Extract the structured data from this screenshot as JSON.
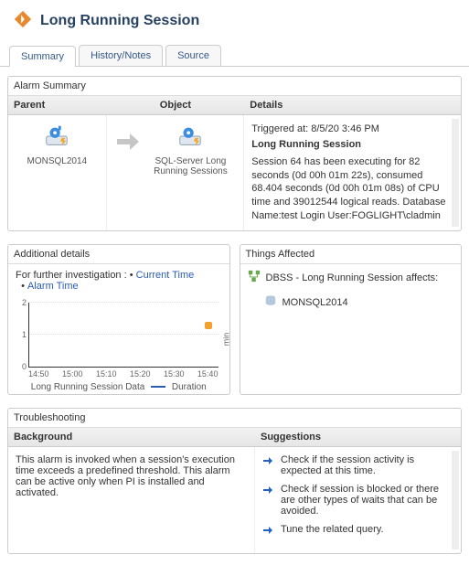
{
  "header": {
    "title": "Long Running Session"
  },
  "tabs": {
    "summary": "Summary",
    "history": "History/Notes",
    "source": "Source"
  },
  "alarm": {
    "panel_title": "Alarm Summary",
    "col_parent": "Parent",
    "col_object": "Object",
    "col_details": "Details",
    "parent_label": "MONSQL2014",
    "object_label": "SQL-Server Long Running Sessions",
    "details": {
      "triggered": "Triggered at: 8/5/20 3:46 PM",
      "title": "Long Running Session",
      "body": "Session 64 has been executing for 82 seconds (0d 00h 01m 22s), consumed 68.404 seconds (0d 00h 01m 08s) of CPU time and 39012544 logical reads. Database Name:test Login User:FOGLIGHT\\cladmin Program Name:Microsoft SQL Server Management Studio - Query Host"
    }
  },
  "additional": {
    "panel_title": "Additional details",
    "prefix": "For further investigation : ",
    "link_current": "Current Time",
    "link_alarm": "Alarm Time",
    "chart_caption_left": "Long Running Session Data",
    "chart_caption_series": "Duration",
    "axis_unit": "min"
  },
  "things": {
    "panel_title": "Things Affected",
    "line1": "DBSS - Long Running Session affects:",
    "child": "MONSQL2014"
  },
  "troubleshoot": {
    "panel_title": "Troubleshooting",
    "col_bg": "Background",
    "col_sugg": "Suggestions",
    "background": "This alarm is invoked when a session's execution time exceeds a predefined threshold. This alarm can be active only when PI is installed and activated.",
    "s1": "Check if the session activity is expected at this time.",
    "s2": "Check if session is blocked or there are other types of waits that can be avoided.",
    "s3": "Tune the related query."
  },
  "chart_data": {
    "type": "scatter",
    "x_ticks": [
      "14:50",
      "15:00",
      "15:10",
      "15:20",
      "15:30",
      "15:40"
    ],
    "y_ticks": [
      0,
      1,
      2
    ],
    "ylabel": "min",
    "series": [
      {
        "name": "Duration",
        "points": [
          {
            "x": "15:44",
            "y": 1.3
          }
        ]
      }
    ],
    "ylim": [
      0,
      2
    ]
  }
}
